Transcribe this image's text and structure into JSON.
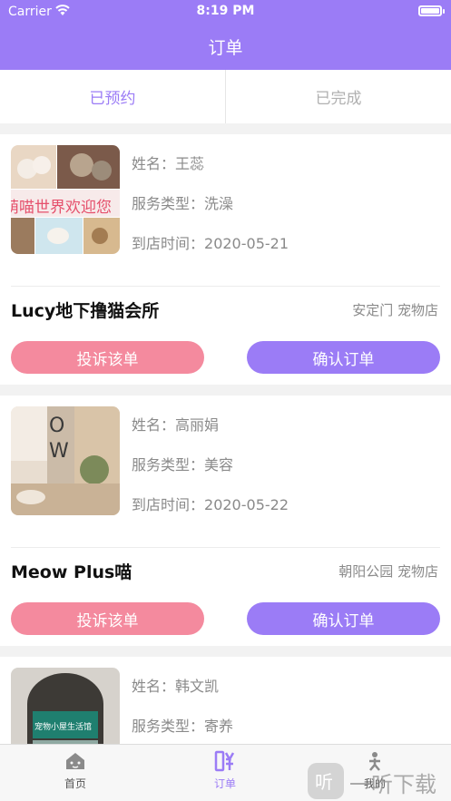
{
  "status_bar": {
    "carrier": "Carrier",
    "time": "8:19 PM"
  },
  "header": {
    "title": "订单"
  },
  "tabs": [
    {
      "label": "已预约"
    },
    {
      "label": "已完成"
    }
  ],
  "labels": {
    "name": "姓名：",
    "service": "服务类型：",
    "time": "到店时间：",
    "complain": "投诉该单",
    "confirm": "确认订单"
  },
  "orders": [
    {
      "photo_text": "萌喵世界欢迎您",
      "name": "王蕊",
      "service": "洗澡",
      "time": "2020-05-21",
      "shop": "Lucy地下撸猫会所",
      "location": "安定门 宠物店"
    },
    {
      "name": "高丽娟",
      "service": "美容",
      "time": "2020-05-22",
      "shop": "Meow Plus喵",
      "location": "朝阳公园 宠物店"
    },
    {
      "photo_text": "宠物小屋生活馆",
      "name": "韩文凯",
      "service": "寄养"
    }
  ],
  "tabbar": {
    "items": [
      {
        "label": "首页",
        "icon": "home-icon"
      },
      {
        "label": "订单",
        "icon": "order-icon",
        "active": true
      },
      {
        "label": "我的",
        "icon": "person-icon"
      }
    ]
  },
  "watermark": {
    "text": "一听下载"
  },
  "colors": {
    "accent": "#9b7cf6",
    "complain": "#f48a9e"
  }
}
